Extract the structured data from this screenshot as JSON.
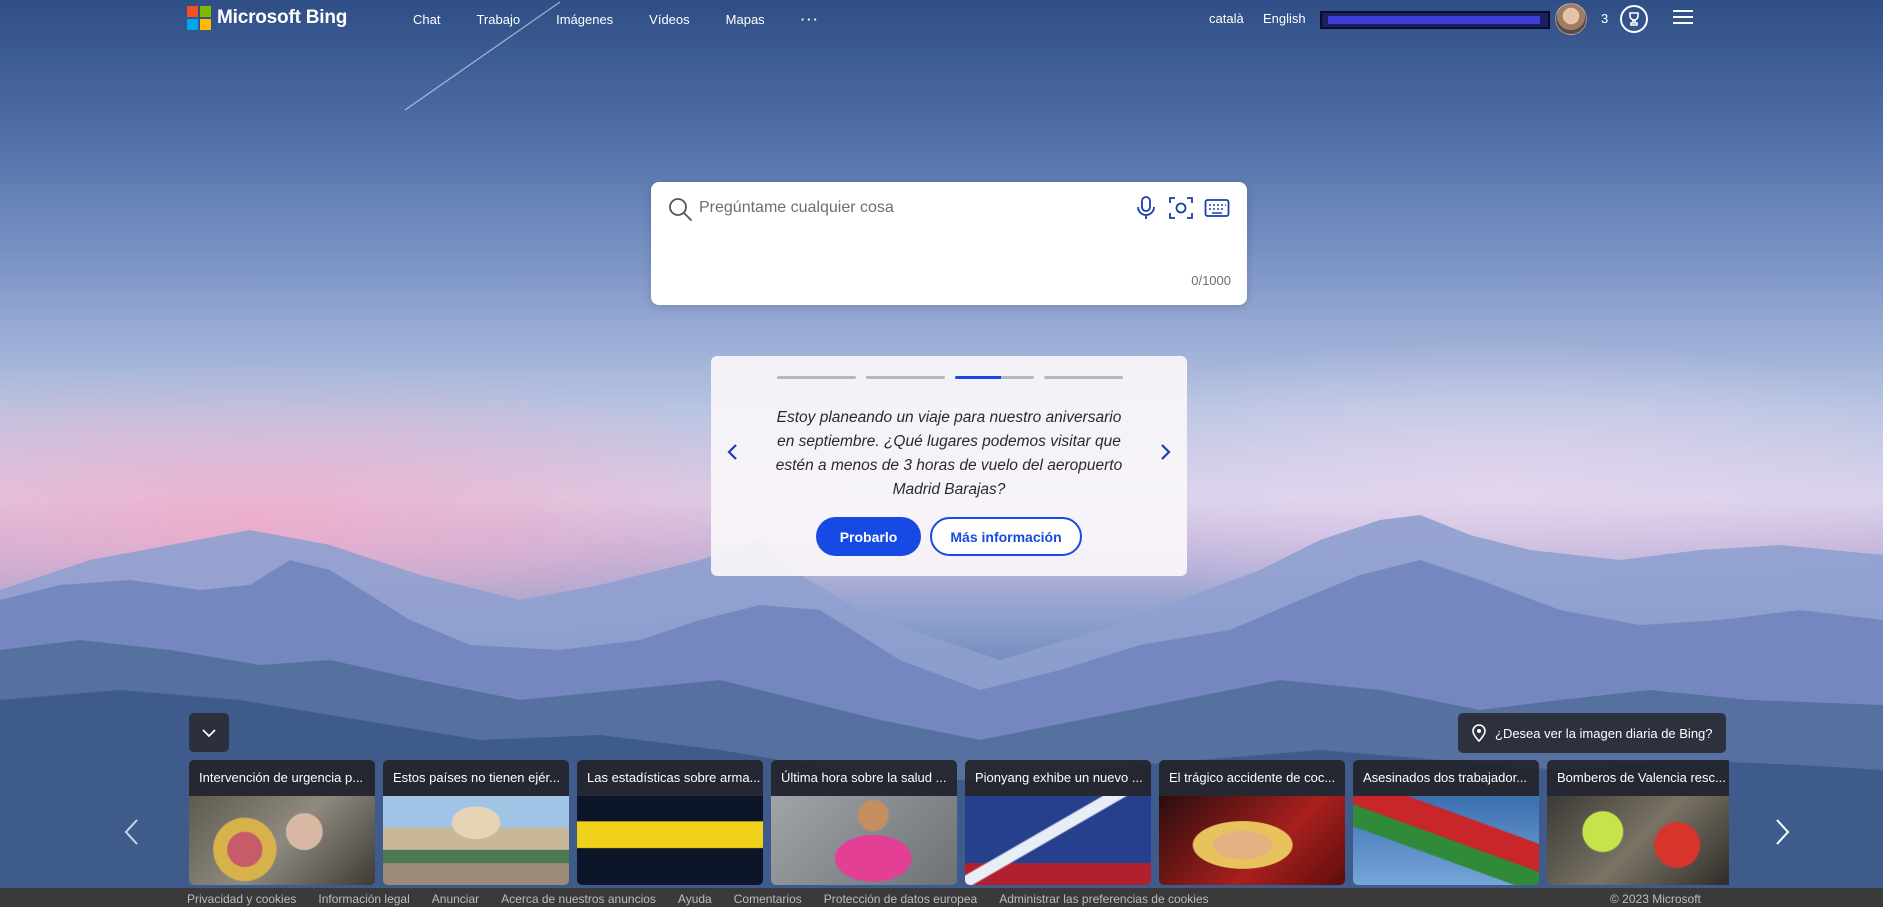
{
  "brand": {
    "name": "Microsoft Bing"
  },
  "nav": {
    "items": [
      "Chat",
      "Trabajo",
      "Imágenes",
      "Vídeos",
      "Mapas"
    ],
    "more_label": "···"
  },
  "header": {
    "lang_primary": "català",
    "lang_secondary": "English",
    "rewards_count": "3"
  },
  "search": {
    "placeholder": "Pregúntame cualquier cosa",
    "value": "",
    "char_count": "0/1000"
  },
  "prompt_card": {
    "text": "Estoy planeando un viaje para nuestro aniversario en septiembre. ¿Qué lugares podemos visitar que estén a menos de 3 horas de vuelo del aeropuerto Madrid Barajas?",
    "try_label": "Probarlo",
    "more_label": "Más información",
    "active_step": 3,
    "step_count": 4
  },
  "daily_image": {
    "label": "¿Desea ver la imagen diaria de Bing?"
  },
  "news": [
    {
      "title": "Intervención de urgencia p...",
      "thumb": "woman-flowers"
    },
    {
      "title": "Estos países no tienen ejér...",
      "thumb": "vatican"
    },
    {
      "title": "Las estadísticas sobre arma...",
      "thumb": "police-tape"
    },
    {
      "title": "Última hora sobre la salud ...",
      "thumb": "woman-pink"
    },
    {
      "title": "Pionyang exhibe un nuevo ...",
      "thumb": "missile"
    },
    {
      "title": "El trágico accidente de coc...",
      "thumb": "blonde-woman"
    },
    {
      "title": "Asesinados dos trabajador...",
      "thumb": "flag"
    },
    {
      "title": "Bomberos de Valencia resc...",
      "thumb": "rescue"
    }
  ],
  "footer": {
    "links": [
      "Privacidad y cookies",
      "Información legal",
      "Anunciar",
      "Acerca de nuestros anuncios",
      "Ayuda",
      "Comentarios",
      "Protección de datos europea",
      "Administrar las preferencias de cookies"
    ],
    "copyright": "© 2023 Microsoft"
  },
  "colors": {
    "accent": "#174ae4",
    "dark_chip": "#28282f"
  }
}
